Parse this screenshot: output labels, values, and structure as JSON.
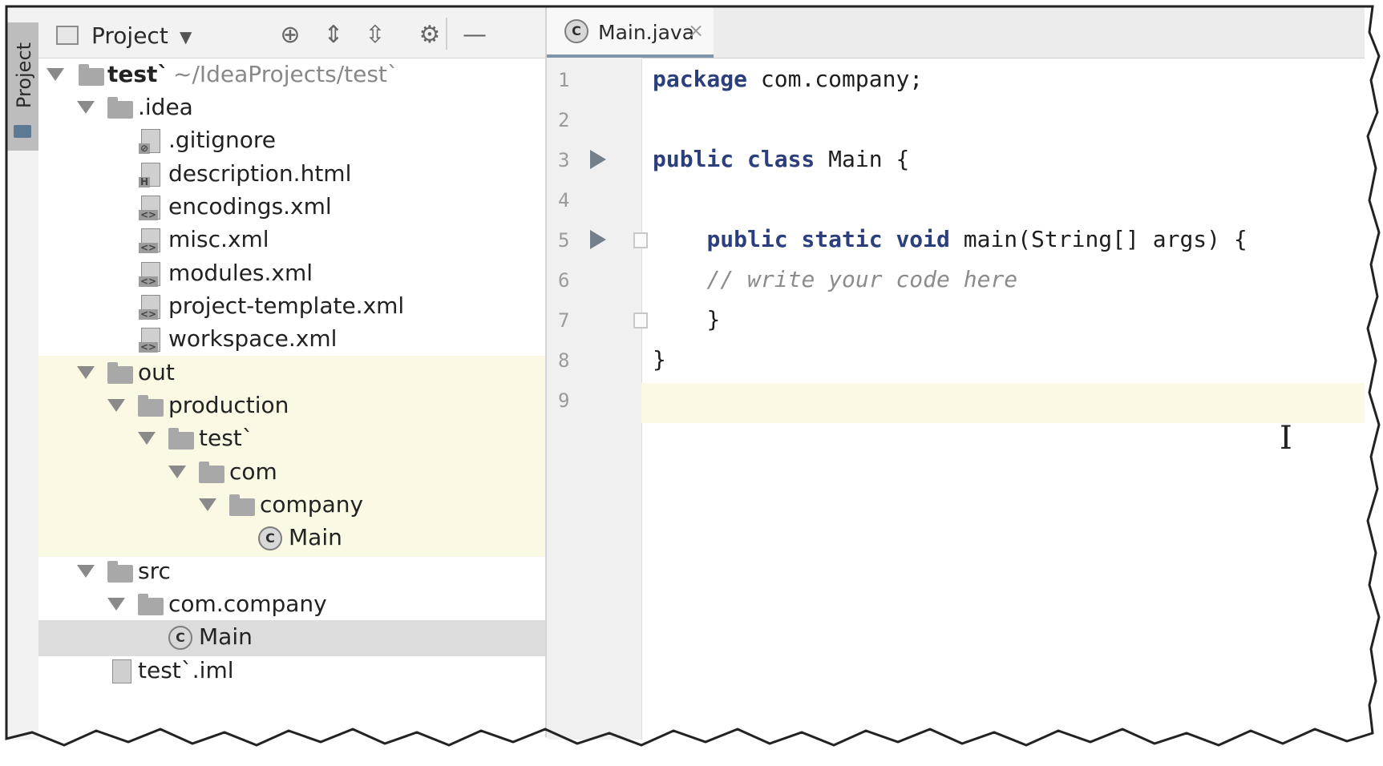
{
  "tool_window": {
    "label": "Project"
  },
  "project_panel": {
    "title": "Project",
    "toolbar_icons": [
      "locate-icon",
      "expand-all-icon",
      "collapse-all-icon",
      "gear-icon",
      "minimize-icon"
    ]
  },
  "tree": {
    "root": {
      "name": "test`",
      "path": "~/IdeaProjects/test`"
    },
    "idea": ".idea",
    "idea_files": [
      ".gitignore",
      "description.html",
      "encodings.xml",
      "misc.xml",
      "modules.xml",
      "project-template.xml",
      "workspace.xml"
    ],
    "out": "out",
    "production": "production",
    "test_dir": "test`",
    "com": "com",
    "company": "company",
    "out_main": "Main",
    "src": "src",
    "com_company": "com.company",
    "src_main": "Main",
    "iml": "test`.iml"
  },
  "editor": {
    "tab_label": "Main.java",
    "tab_close": "×",
    "line_numbers": [
      "1",
      "2",
      "3",
      "4",
      "5",
      "6",
      "7",
      "8",
      "9"
    ],
    "code": {
      "l1_kw": "package",
      "l1_rest": " com.company;",
      "l3_kw": "public class",
      "l3_rest": " Main {",
      "l5_kw": "public static void",
      "l5_rest": " main(String[] args) {",
      "l6_comment": "// write your code here",
      "l7": "}",
      "l8": "}"
    },
    "current_line": 9
  },
  "colors": {
    "highlight": "#fbf9e4",
    "selection": "#dcdcdc",
    "keyword": "#2c3f7d",
    "comment": "#8c8c8c"
  }
}
